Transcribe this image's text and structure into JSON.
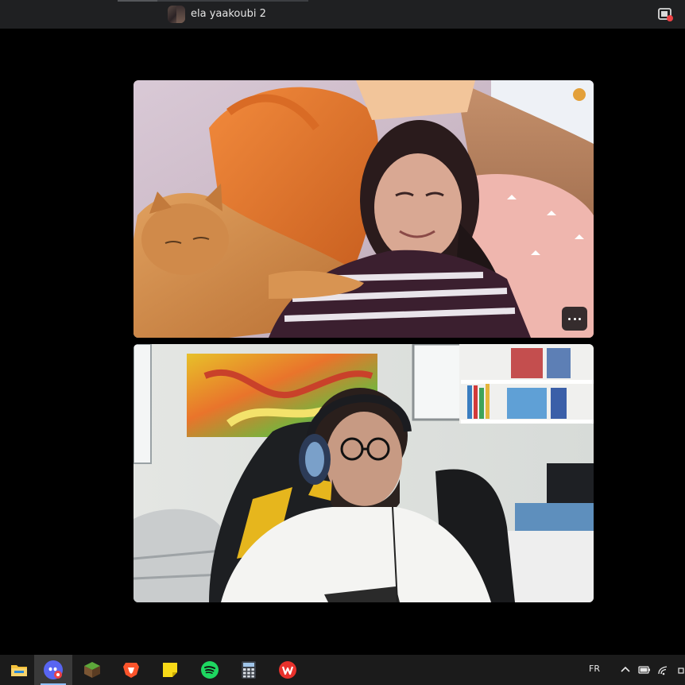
{
  "window": {
    "call_title": "ela yaakoubi 2",
    "accent_color": "#e3a03a"
  },
  "participants": [
    {
      "name": "ela yaakoubi",
      "tile_label": "participant video tile"
    },
    {
      "name": "",
      "tile_label": "self video tile"
    }
  ],
  "tile_controls": {
    "more_icon": "more-horizontal-icon",
    "info_icon": "info-icon"
  },
  "taskbar": {
    "apps": [
      {
        "name": "file-explorer",
        "icon": "folder-icon",
        "active": false,
        "running": false
      },
      {
        "name": "discord",
        "icon": "discord-icon",
        "active": true,
        "running": true
      },
      {
        "name": "minecraft",
        "icon": "minecraft-block-icon",
        "active": false,
        "running": false
      },
      {
        "name": "brave",
        "icon": "brave-lion-icon",
        "active": false,
        "running": false
      },
      {
        "name": "sticky-notes",
        "icon": "sticky-note-icon",
        "active": false,
        "running": false
      },
      {
        "name": "spotify",
        "icon": "spotify-icon",
        "active": false,
        "running": false
      },
      {
        "name": "calculator",
        "icon": "calculator-icon",
        "active": false,
        "running": false
      },
      {
        "name": "wps-office",
        "icon": "wps-icon",
        "active": false,
        "running": false
      }
    ],
    "tray": {
      "language": "FR",
      "icons": [
        "chevron-up-icon",
        "battery-icon",
        "wifi-icon"
      ]
    }
  }
}
